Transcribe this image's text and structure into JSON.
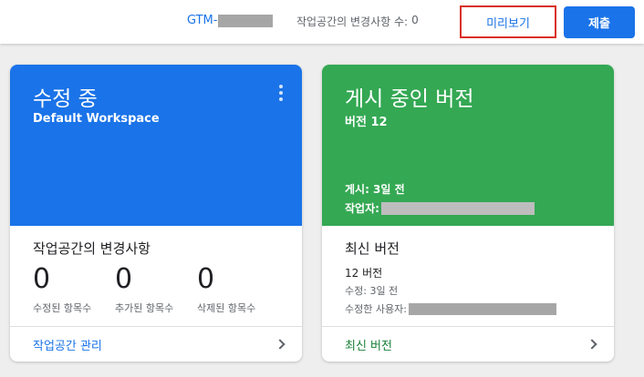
{
  "header": {
    "container_id": "GTM-",
    "workspace_changes_label": "작업공간의 변경사항 수:",
    "workspace_changes_count": "0",
    "preview_label": "미리보기",
    "submit_label": "제출"
  },
  "editing_card": {
    "title": "수정 중",
    "workspace_name": "Default Workspace",
    "changes_title": "작업공간의 변경사항",
    "counters": [
      {
        "value": "0",
        "label": "수정된 항목수"
      },
      {
        "value": "0",
        "label": "추가된 항목수"
      },
      {
        "value": "0",
        "label": "삭제된 항목수"
      }
    ],
    "footer_link": "작업공간 관리",
    "header_color": "#1a73e8"
  },
  "live_card": {
    "title": "게시 중인 버전",
    "version": "버전 12",
    "published": "게시: 3일 전",
    "author_label": "작업자:",
    "latest_title": "최신 버전",
    "latest_version": "12 버전",
    "modified": "수정: 3일 전",
    "modified_by_label": "수정한 사용자:",
    "footer_link": "최신 버전",
    "header_color": "#34a853"
  },
  "icons": [
    "more-vert-icon",
    "chevron-right-icon"
  ]
}
